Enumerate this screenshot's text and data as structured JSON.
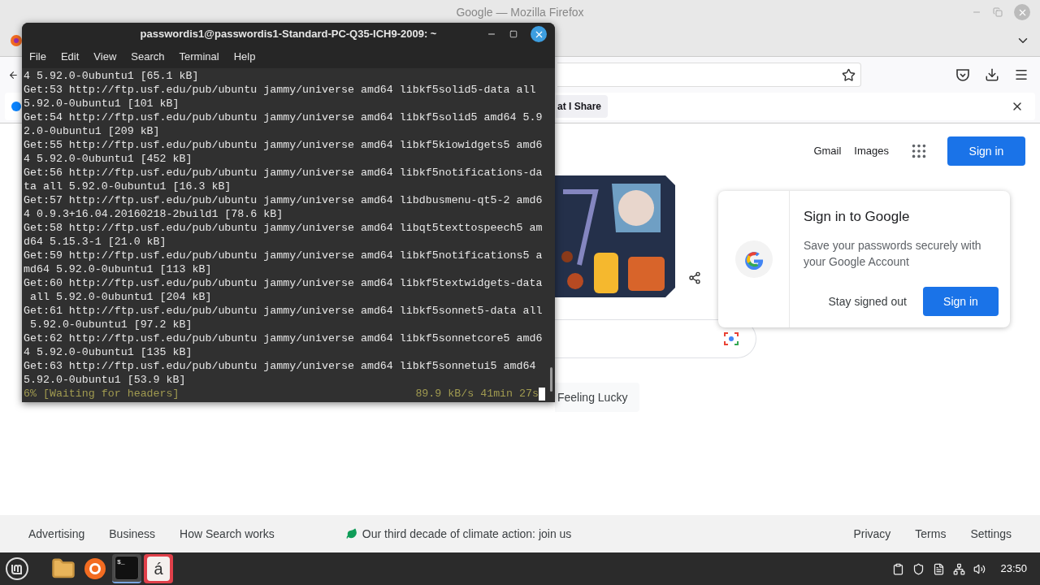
{
  "firefox": {
    "title": "Google — Mozilla Firefox",
    "notification": {
      "button": "at I Share"
    }
  },
  "google": {
    "header_links": [
      "Gmail",
      "Images"
    ],
    "sign_in": "Sign in",
    "feeling_lucky": "Feeling Lucky",
    "popup": {
      "title": "Sign in to Google",
      "body": "Save your passwords securely with your Google Account",
      "secondary": "Stay signed out",
      "primary": "Sign in"
    },
    "footer": {
      "left": [
        "Advertising",
        "Business",
        "How Search works"
      ],
      "center": "Our third decade of climate action: join us",
      "right": [
        "Privacy",
        "Terms",
        "Settings"
      ]
    }
  },
  "terminal": {
    "title": "passwordis1@passwordis1-Standard-PC-Q35-ICH9-2009: ~",
    "menu": [
      "File",
      "Edit",
      "View",
      "Search",
      "Terminal",
      "Help"
    ],
    "lines": [
      "4 5.92.0-0ubuntu1 [65.1 kB]",
      "Get:53 http://ftp.usf.edu/pub/ubuntu jammy/universe amd64 libkf5solid5-data all",
      "5.92.0-0ubuntu1 [101 kB]",
      "Get:54 http://ftp.usf.edu/pub/ubuntu jammy/universe amd64 libkf5solid5 amd64 5.9",
      "2.0-0ubuntu1 [209 kB]",
      "Get:55 http://ftp.usf.edu/pub/ubuntu jammy/universe amd64 libkf5kiowidgets5 amd6",
      "4 5.92.0-0ubuntu1 [452 kB]",
      "Get:56 http://ftp.usf.edu/pub/ubuntu jammy/universe amd64 libkf5notifications-da",
      "ta all 5.92.0-0ubuntu1 [16.3 kB]",
      "Get:57 http://ftp.usf.edu/pub/ubuntu jammy/universe amd64 libdbusmenu-qt5-2 amd6",
      "4 0.9.3+16.04.20160218-2build1 [78.6 kB]",
      "Get:58 http://ftp.usf.edu/pub/ubuntu jammy/universe amd64 libqt5texttospeech5 am",
      "d64 5.15.3-1 [21.0 kB]",
      "Get:59 http://ftp.usf.edu/pub/ubuntu jammy/universe amd64 libkf5notifications5 a",
      "md64 5.92.0-0ubuntu1 [113 kB]",
      "Get:60 http://ftp.usf.edu/pub/ubuntu jammy/universe amd64 libkf5textwidgets-data",
      " all 5.92.0-0ubuntu1 [204 kB]",
      "Get:61 http://ftp.usf.edu/pub/ubuntu jammy/universe amd64 libkf5sonnet5-data all",
      " 5.92.0-0ubuntu1 [97.2 kB]",
      "Get:62 http://ftp.usf.edu/pub/ubuntu jammy/universe amd64 libkf5sonnetcore5 amd6",
      "4 5.92.0-0ubuntu1 [135 kB]",
      "Get:63 http://ftp.usf.edu/pub/ubuntu jammy/universe amd64 libkf5sonnetui5 amd64",
      "5.92.0-0ubuntu1 [53.9 kB]"
    ],
    "status": {
      "left": "6% [Waiting for headers]",
      "right": "89.9 kB/s 41min 27s"
    }
  },
  "taskbar": {
    "apps": [
      {
        "kind": "files",
        "selected": false
      },
      {
        "kind": "browser",
        "selected": false
      },
      {
        "kind": "terminal",
        "label": "$_",
        "selected": true
      },
      {
        "kind": "text",
        "label": "á",
        "selected": false
      }
    ],
    "clock": "23:50"
  }
}
